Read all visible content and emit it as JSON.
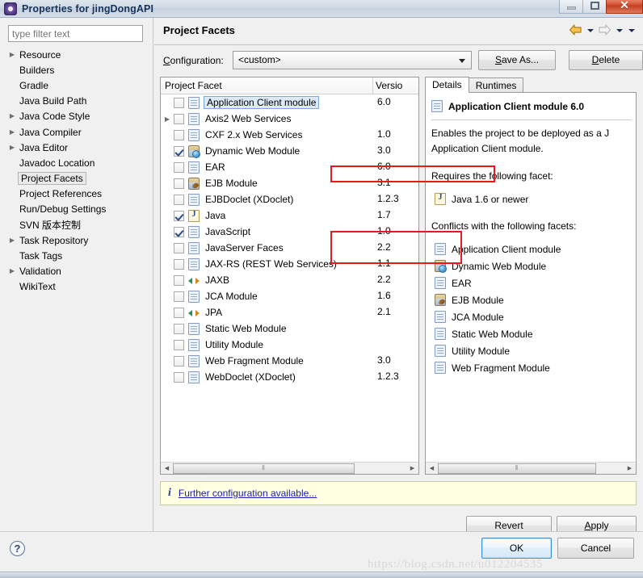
{
  "window": {
    "title": "Properties for jingDongAPI",
    "icon": "gear-icon",
    "minimize_label": "",
    "maximize_label": "",
    "close_label": "✕"
  },
  "sidebar": {
    "filter_placeholder": "type filter text",
    "filter_value": "",
    "items": [
      {
        "label": "Resource",
        "expandable": true,
        "selected": false
      },
      {
        "label": "Builders",
        "expandable": false,
        "selected": false
      },
      {
        "label": "Gradle",
        "expandable": false,
        "selected": false
      },
      {
        "label": "Java Build Path",
        "expandable": false,
        "selected": false
      },
      {
        "label": "Java Code Style",
        "expandable": true,
        "selected": false
      },
      {
        "label": "Java Compiler",
        "expandable": true,
        "selected": false
      },
      {
        "label": "Java Editor",
        "expandable": true,
        "selected": false
      },
      {
        "label": "Javadoc Location",
        "expandable": false,
        "selected": false
      },
      {
        "label": "Project Facets",
        "expandable": false,
        "selected": true
      },
      {
        "label": "Project References",
        "expandable": false,
        "selected": false
      },
      {
        "label": "Run/Debug Settings",
        "expandable": false,
        "selected": false
      },
      {
        "label": "SVN 版本控制",
        "expandable": false,
        "selected": false
      },
      {
        "label": "Task Repository",
        "expandable": true,
        "selected": false
      },
      {
        "label": "Task Tags",
        "expandable": false,
        "selected": false
      },
      {
        "label": "Validation",
        "expandable": true,
        "selected": false
      },
      {
        "label": "WikiText",
        "expandable": false,
        "selected": false
      }
    ]
  },
  "page": {
    "title": "Project Facets",
    "nav": {
      "back_icon": "arrow-left-icon",
      "back_menu_icon": "chevron-down-icon",
      "forward_icon": "arrow-right-icon",
      "forward_menu_icon": "chevron-down-icon",
      "view_menu_icon": "chevron-down-icon"
    }
  },
  "configuration": {
    "label": "Configuration:",
    "label_mnemonic": "C",
    "selected": "<custom>",
    "options": [
      "<custom>"
    ],
    "save_as_label": "Save As...",
    "save_as_mnemonic": "S",
    "delete_label": "Delete",
    "delete_mnemonic": "D"
  },
  "facet_table": {
    "columns": [
      "Project Facet",
      "Versio"
    ],
    "rows": [
      {
        "name": "Application Client module",
        "version": "6.0",
        "checked": false,
        "icon": "document-icon",
        "expandable": false,
        "selected": true
      },
      {
        "name": "Axis2 Web Services",
        "version": "",
        "checked": false,
        "icon": "document-icon",
        "expandable": true,
        "selected": false
      },
      {
        "name": "CXF 2.x Web Services",
        "version": "1.0",
        "checked": false,
        "icon": "document-icon",
        "expandable": false,
        "selected": false
      },
      {
        "name": "Dynamic Web Module",
        "version": "3.0",
        "checked": true,
        "icon": "web-module-icon",
        "expandable": false,
        "selected": false
      },
      {
        "name": "EAR",
        "version": "6.0",
        "checked": false,
        "icon": "document-icon",
        "expandable": false,
        "selected": false
      },
      {
        "name": "EJB Module",
        "version": "3.1",
        "checked": false,
        "icon": "ejb-icon",
        "expandable": false,
        "selected": false
      },
      {
        "name": "EJBDoclet (XDoclet)",
        "version": "1.2.3",
        "checked": false,
        "icon": "document-icon",
        "expandable": false,
        "selected": false
      },
      {
        "name": "Java",
        "version": "1.7",
        "checked": true,
        "icon": "java-icon",
        "expandable": false,
        "selected": false
      },
      {
        "name": "JavaScript",
        "version": "1.0",
        "checked": true,
        "icon": "document-icon",
        "expandable": false,
        "selected": false
      },
      {
        "name": "JavaServer Faces",
        "version": "2.2",
        "checked": false,
        "icon": "document-icon",
        "expandable": false,
        "selected": false
      },
      {
        "name": "JAX-RS (REST Web Services)",
        "version": "1.1",
        "checked": false,
        "icon": "document-icon",
        "expandable": false,
        "selected": false
      },
      {
        "name": "JAXB",
        "version": "2.2",
        "checked": false,
        "icon": "arrows-icon",
        "expandable": false,
        "selected": false
      },
      {
        "name": "JCA Module",
        "version": "1.6",
        "checked": false,
        "icon": "document-icon",
        "expandable": false,
        "selected": false
      },
      {
        "name": "JPA",
        "version": "2.1",
        "checked": false,
        "icon": "arrows-icon",
        "expandable": false,
        "selected": false
      },
      {
        "name": "Static Web Module",
        "version": "",
        "checked": false,
        "icon": "document-icon",
        "expandable": false,
        "selected": false
      },
      {
        "name": "Utility Module",
        "version": "",
        "checked": false,
        "icon": "document-icon",
        "expandable": false,
        "selected": false
      },
      {
        "name": "Web Fragment Module",
        "version": "3.0",
        "checked": false,
        "icon": "document-icon",
        "expandable": false,
        "selected": false
      },
      {
        "name": "WebDoclet (XDoclet)",
        "version": "1.2.3",
        "checked": false,
        "icon": "document-icon",
        "expandable": false,
        "selected": false
      }
    ],
    "annotations": [
      {
        "name": "highlight-dynamic-web-module",
        "color": "#e8191b"
      },
      {
        "name": "highlight-java-javascript",
        "color": "#e8191b"
      }
    ]
  },
  "details": {
    "tabs": [
      {
        "label": "Details",
        "mnemonic": "t",
        "active": true
      },
      {
        "label": "Runtimes",
        "mnemonic": "R",
        "active": false
      }
    ],
    "heading": "Application Client module 6.0",
    "heading_icon": "document-icon",
    "description_line1": "Enables the project to be deployed as a J",
    "description_line2": "Application Client module.",
    "requires_label": "Requires the following facet:",
    "requires": [
      {
        "label": "Java 1.6 or newer",
        "icon": "java-icon"
      }
    ],
    "conflicts_label": "Conflicts with the following facets:",
    "conflicts": [
      {
        "label": "Application Client module",
        "icon": "document-icon"
      },
      {
        "label": "Dynamic Web Module",
        "icon": "web-module-icon"
      },
      {
        "label": "EAR",
        "icon": "document-icon"
      },
      {
        "label": "EJB Module",
        "icon": "ejb-icon"
      },
      {
        "label": "JCA Module",
        "icon": "document-icon"
      },
      {
        "label": "Static Web Module",
        "icon": "document-icon"
      },
      {
        "label": "Utility Module",
        "icon": "document-icon"
      },
      {
        "label": "Web Fragment Module",
        "icon": "document-icon"
      }
    ]
  },
  "info_bar": {
    "icon": "info-icon",
    "link_text": "Further configuration available..."
  },
  "actions": {
    "revert_label": "Revert",
    "apply_label": "Apply",
    "apply_mnemonic": "A",
    "ok_label": "OK",
    "cancel_label": "Cancel",
    "help_label": "?"
  },
  "watermark": "https://blog.csdn.net/u012204535",
  "colors": {
    "annotation_red": "#e8191b",
    "info_background": "#ffffe1",
    "selection_blue": "#dce9f7",
    "default_button_border": "#3c8fd0"
  }
}
